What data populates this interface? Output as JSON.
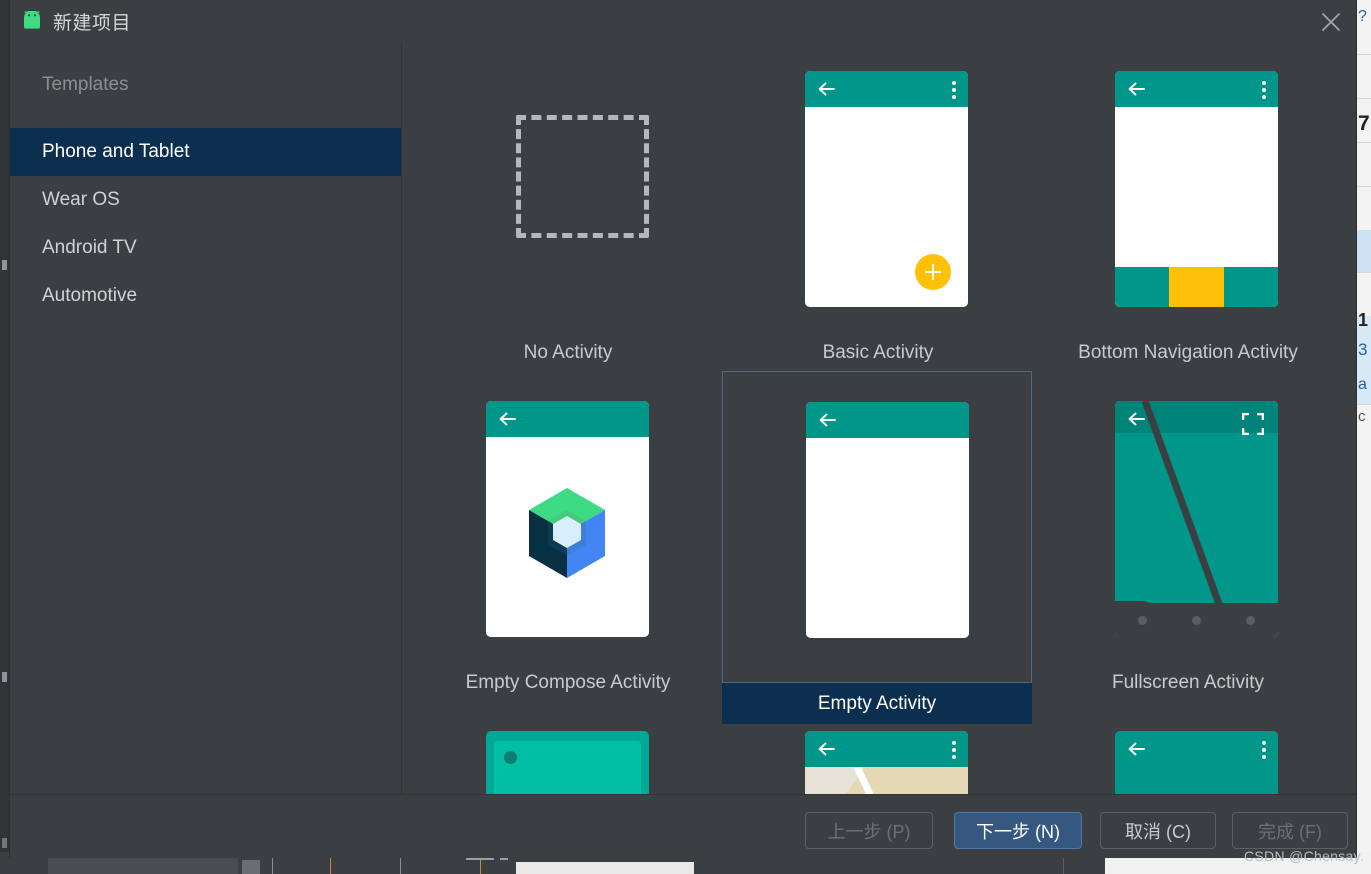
{
  "dialog": {
    "title": "新建项目",
    "app_icon": "android-robot-icon",
    "close_icon": "close-icon"
  },
  "sidebar": {
    "header": "Templates",
    "items": [
      {
        "label": "Phone and Tablet",
        "selected": true
      },
      {
        "label": "Wear OS",
        "selected": false
      },
      {
        "label": "Android TV",
        "selected": false
      },
      {
        "label": "Automotive",
        "selected": false
      }
    ]
  },
  "templates": [
    {
      "label": "No Activity",
      "kind": "no-activity",
      "selected": false
    },
    {
      "label": "Basic Activity",
      "kind": "basic-activity",
      "selected": false
    },
    {
      "label": "Bottom Navigation Activity",
      "kind": "bottom-nav-activity",
      "selected": false
    },
    {
      "label": "Empty Compose Activity",
      "kind": "empty-compose-activity",
      "selected": false
    },
    {
      "label": "Empty Activity",
      "kind": "empty-activity",
      "selected": true
    },
    {
      "label": "Fullscreen Activity",
      "kind": "fullscreen-activity",
      "selected": false
    },
    {
      "label": "",
      "kind": "partial-landscape",
      "selected": false
    },
    {
      "label": "",
      "kind": "partial-map",
      "selected": false
    },
    {
      "label": "",
      "kind": "partial-login",
      "selected": false
    }
  ],
  "footer": {
    "previous": {
      "label": "上一步 (P)",
      "enabled": false
    },
    "next": {
      "label": "下一步 (N)",
      "enabled": true,
      "mnemonic": "N"
    },
    "cancel": {
      "label": "取消 (C)",
      "enabled": true,
      "mnemonic": "C"
    },
    "finish": {
      "label": "完成 (F)",
      "enabled": false
    }
  },
  "watermark": "CSDN @Chensay.",
  "colors": {
    "dialog_bg": "#3c3f41",
    "selection_blue": "#0d2f4f",
    "primary_button": "#365880",
    "teal": "#00968a",
    "amber": "#ffc107",
    "text": "#c8cbcd"
  },
  "background": {
    "cells": [
      "7",
      "1",
      "3",
      "a",
      "c"
    ]
  }
}
